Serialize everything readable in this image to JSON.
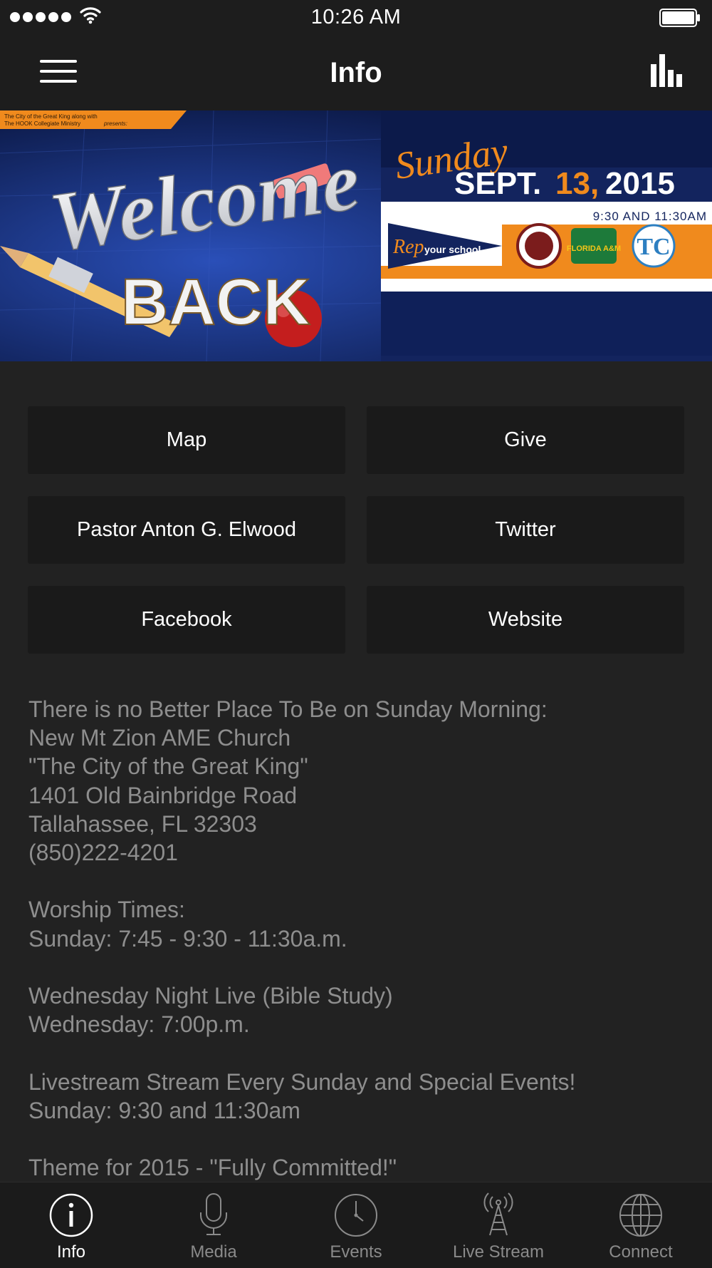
{
  "status_bar": {
    "time": "10:26 AM"
  },
  "header": {
    "title": "Info",
    "menu_icon": "hamburger-menu-icon",
    "stats_icon": "bar-chart-icon"
  },
  "banner": {
    "top_left": [
      "The City of the Great King along with",
      "The HOOK Collegiate Ministry",
      "presents:"
    ],
    "welcome": "Welcome",
    "back": "BACK",
    "day": "Sunday",
    "date_a": "SEPT.",
    "date_b": "13,",
    "date_c": "2015",
    "times": "9:30 AND 11:30AM",
    "rep": "Rep",
    "rep_rest": "your school",
    "logo_famu": "FLORIDA A&M"
  },
  "buttons": [
    {
      "label": "Map"
    },
    {
      "label": "Give"
    },
    {
      "label": "Pastor Anton G. Elwood"
    },
    {
      "label": "Twitter"
    },
    {
      "label": "Facebook"
    },
    {
      "label": "Website"
    }
  ],
  "info_text": "There is no Better Place To Be on Sunday Morning:\nNew Mt Zion AME Church\n\"The City of the Great King\"\n1401 Old Bainbridge Road\nTallahassee, FL 32303\n(850)222-4201\n\nWorship Times:\nSunday: 7:45 - 9:30 - 11:30a.m.\n\nWednesday Night Live (Bible Study)\nWednesday: 7:00p.m.\n\nLivestream Stream Every Sunday and Special Events!\nSunday: 9:30 and 11:30am\n\nTheme for 2015 - \"Fully Committed!\"",
  "tabs": [
    {
      "label": "Info",
      "icon": "info-icon",
      "active": true
    },
    {
      "label": "Media",
      "icon": "microphone-icon",
      "active": false
    },
    {
      "label": "Events",
      "icon": "clock-icon",
      "active": false
    },
    {
      "label": "Live Stream",
      "icon": "broadcast-tower-icon",
      "active": false
    },
    {
      "label": "Connect",
      "icon": "globe-icon",
      "active": false
    }
  ],
  "colors": {
    "background": "#222222",
    "button": "#1a1a1a",
    "body_text": "#8e8e8e",
    "banner_orange": "#f08a1d",
    "banner_navy": "#13245e"
  }
}
